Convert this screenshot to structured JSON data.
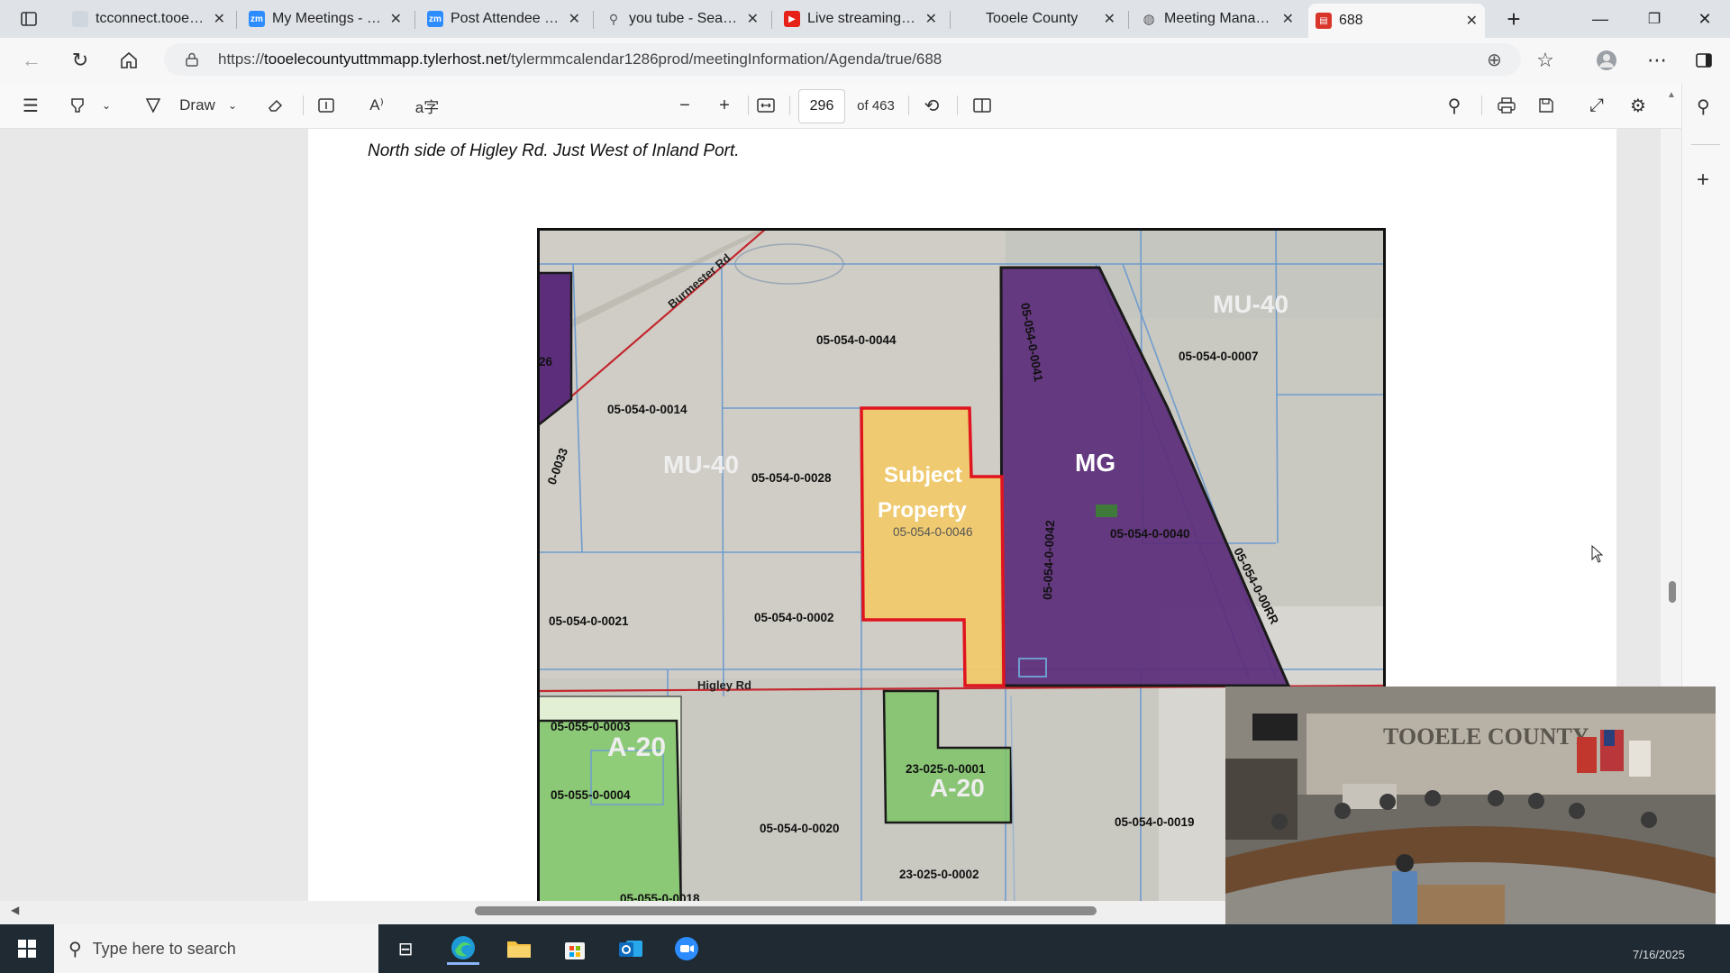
{
  "browser": {
    "tabs": [
      {
        "title": "tcconnect.tooeleco",
        "icon": "page-icon"
      },
      {
        "title": "My Meetings - Zo",
        "icon": "zoom-icon"
      },
      {
        "title": "Post Attendee - Zo",
        "icon": "zoom-icon"
      },
      {
        "title": "you tube - Search",
        "icon": "search-icon"
      },
      {
        "title": "Live streaming - Y",
        "icon": "youtube-icon"
      },
      {
        "title": "Tooele County",
        "icon": "page-icon"
      },
      {
        "title": "Meeting Manager",
        "icon": "globe-icon"
      },
      {
        "title": "688",
        "icon": "pdf-icon"
      }
    ],
    "url_prefix": "https://",
    "url_domain": "tooelecountyuttmmapp.tylerhost.net",
    "url_path": "/tylermmcalendar1286prod/meetingInformation/Agenda/true/688"
  },
  "pdf_toolbar": {
    "draw_label": "Draw",
    "page_current": "296",
    "page_total": "of 463"
  },
  "document": {
    "caption": "North side of Higley Rd.  Just West of Inland Port.",
    "map": {
      "roads": {
        "burmester": "Burmester Rd",
        "higley": "Higley Rd"
      },
      "zones": {
        "mu40_a": "MU-40",
        "mu40_b": "MU-40",
        "mg": "MG",
        "a20_a": "A-20",
        "a20_b": "A-20"
      },
      "subject_line1": "Subject",
      "subject_line2": "Property",
      "parcels": {
        "p0044": "05-054-0-0044",
        "p0007": "05-054-0-0007",
        "p0041": "05-054-0-0041",
        "p0014": "05-054-0-0014",
        "p0028": "05-054-0-0028",
        "p0046": "05-054-0-0046",
        "p0040": "05-054-0-0040",
        "p0042": "05-054-0-0042",
        "p00rr": "05-054-0-00RR",
        "p0033": "0-0033",
        "p26": "26",
        "p0021": "05-054-0-0021",
        "p0002": "05-054-0-0002",
        "p0003": "05-055-0-0003",
        "p0004": "05-055-0-0004",
        "p0020": "05-054-0-0020",
        "p0018": "05-055-0-0018",
        "p0001": "23-025-0-0001",
        "p0002b": "23-025-0-0002",
        "p0019": "05-054-0-0019"
      }
    }
  },
  "taskbar": {
    "search_placeholder": "Type here to search",
    "date": "7/16/2025"
  },
  "video": {
    "banner": "TOOELE COUNTY"
  },
  "colors": {
    "subject_fill": "#f0c96b",
    "subject_border": "#e0141e",
    "mg_fill": "#5b2d7a",
    "a20_fill": "#7fc46a",
    "parcel_line": "#6f9ccf"
  }
}
